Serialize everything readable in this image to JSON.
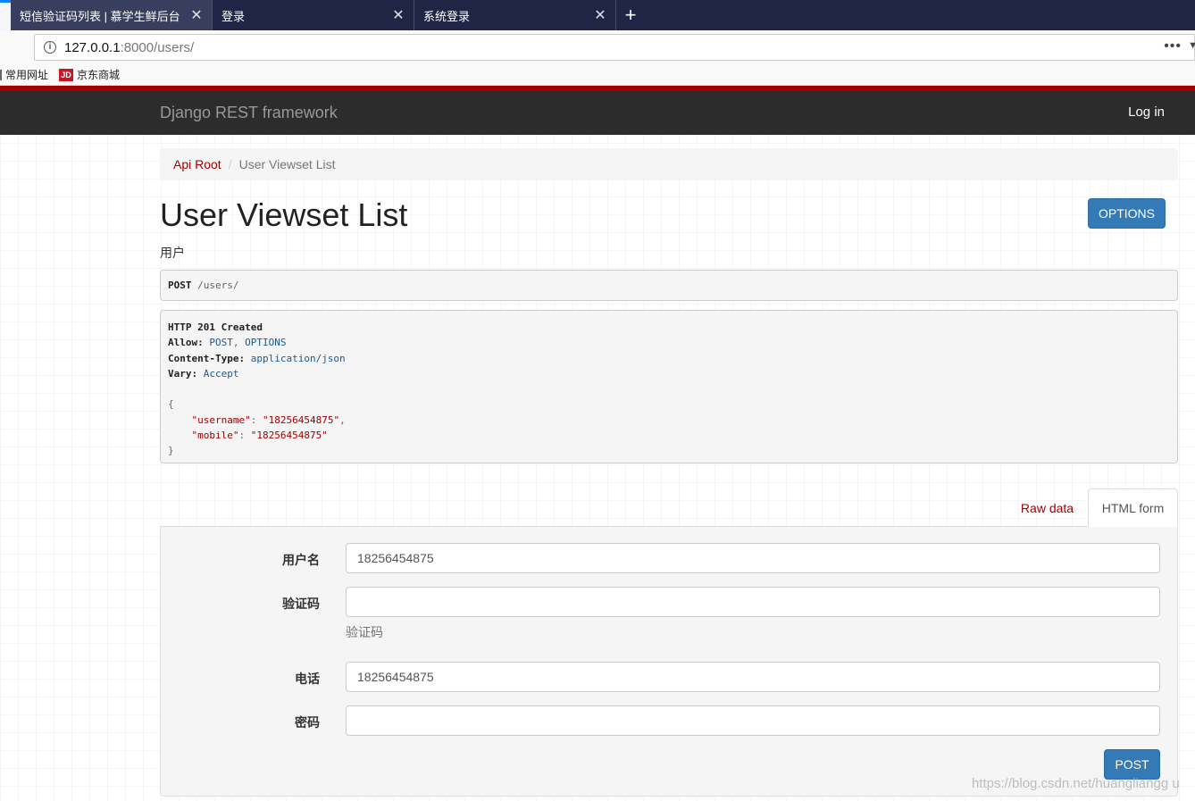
{
  "browser": {
    "tabs": [
      {
        "title": "短信验证码列表 | 慕学生鲜后台",
        "close": "✕",
        "active": true
      },
      {
        "title": "登录",
        "close": "✕",
        "active": false
      },
      {
        "title": "系统登录",
        "close": "✕",
        "active": false
      }
    ],
    "new_tab": "+",
    "url_host": "127.0.0.1",
    "url_path": ":8000/users/",
    "url_more": "•••",
    "bookmarks": [
      {
        "label": "常用网址"
      },
      {
        "label": "京东商城",
        "icon_text": "JD"
      }
    ]
  },
  "drf": {
    "brand": "Django REST framework",
    "login": "Log in",
    "breadcrumb": {
      "root": "Api Root",
      "separator": "/",
      "current": "User Viewset List"
    },
    "title": "User Viewset List",
    "options_label": "OPTIONS",
    "description": "用户",
    "request": {
      "method": "POST",
      "path": "/users/"
    },
    "response": {
      "status": "HTTP 201 Created",
      "headers": [
        {
          "key": "Allow:",
          "parts": [
            "POST",
            ", ",
            "OPTIONS"
          ]
        },
        {
          "key": "Content-Type:",
          "parts": [
            "application/json"
          ]
        },
        {
          "key": "Vary:",
          "parts": [
            "Accept"
          ]
        }
      ],
      "body_open": "{",
      "body_close": "}",
      "body": [
        {
          "key": "\"username\"",
          "value": "\"18256454875\"",
          "trail": ","
        },
        {
          "key": "\"mobile\"",
          "value": "\"18256454875\"",
          "trail": ""
        }
      ]
    },
    "form_tabs": {
      "raw": "Raw data",
      "html": "HTML form"
    },
    "form": {
      "fields": [
        {
          "label": "用户名",
          "value": "18256454875",
          "help": ""
        },
        {
          "label": "验证码",
          "value": "",
          "help": "验证码"
        },
        {
          "label": "电话",
          "value": "18256454875",
          "help": ""
        },
        {
          "label": "密码",
          "value": "",
          "help": ""
        }
      ],
      "submit": "POST"
    }
  },
  "watermark": "https://blog.csdn.net/huangliangg u",
  "colors": {
    "brand_red": "#a30000",
    "navbar": "#2c2c2c",
    "primary": "#337ab7",
    "browser_tabbar": "#212545"
  }
}
